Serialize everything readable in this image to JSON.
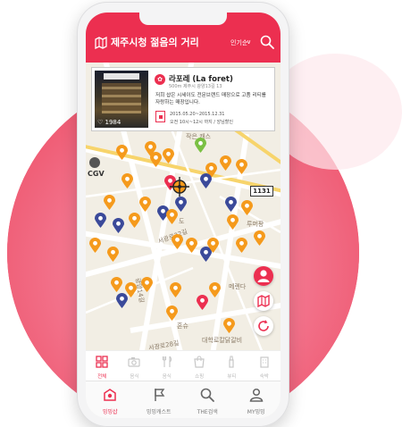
{
  "header": {
    "title": "제주시청 젊음의 거리",
    "sort_label": "인기순",
    "sort_chevron": "∨"
  },
  "place_card": {
    "name": "라포레 (La foret)",
    "address": "500m 제주시 광양13길 13",
    "description": "저희 샵은 시세이도 전문브랜드 매장으로 고품 리티를 자랑하는 매장입니다.",
    "period": "2015.05.20~2015.12.31",
    "hours": "오전 10시~12시 까지 / 앙님할인",
    "likes": "1984"
  },
  "map": {
    "labels": {
      "cgv": "CGV",
      "road_number": "1131",
      "street_1": "작은 캐스",
      "street_2": "서광로32길",
      "street_3": "광양14길",
      "street_4": "서광로28길",
      "place_1": "루머팡",
      "place_2": "메렌다",
      "place_3": "혼슈",
      "place_4": "대학로칼닭갈비",
      "place_5": "도"
    }
  },
  "categories": [
    {
      "label": "전체",
      "active": true
    },
    {
      "label": "음식",
      "active": false
    },
    {
      "label": "음식",
      "active": false
    },
    {
      "label": "쇼핑",
      "active": false
    },
    {
      "label": "뷰티",
      "active": false
    },
    {
      "label": "숙박",
      "active": false
    }
  ],
  "tabs": [
    {
      "label": "밍밍샵",
      "active": true
    },
    {
      "label": "밍밍캐스트",
      "active": false
    },
    {
      "label": "THE검색",
      "active": false
    },
    {
      "label": "MY밍밍",
      "active": false
    }
  ],
  "colors": {
    "brand": "#ec2f50",
    "pin_orange": "#f59a1c",
    "pin_blue": "#3b4a9a",
    "pin_green": "#7ac043",
    "background_circle": "#ef5b73"
  }
}
